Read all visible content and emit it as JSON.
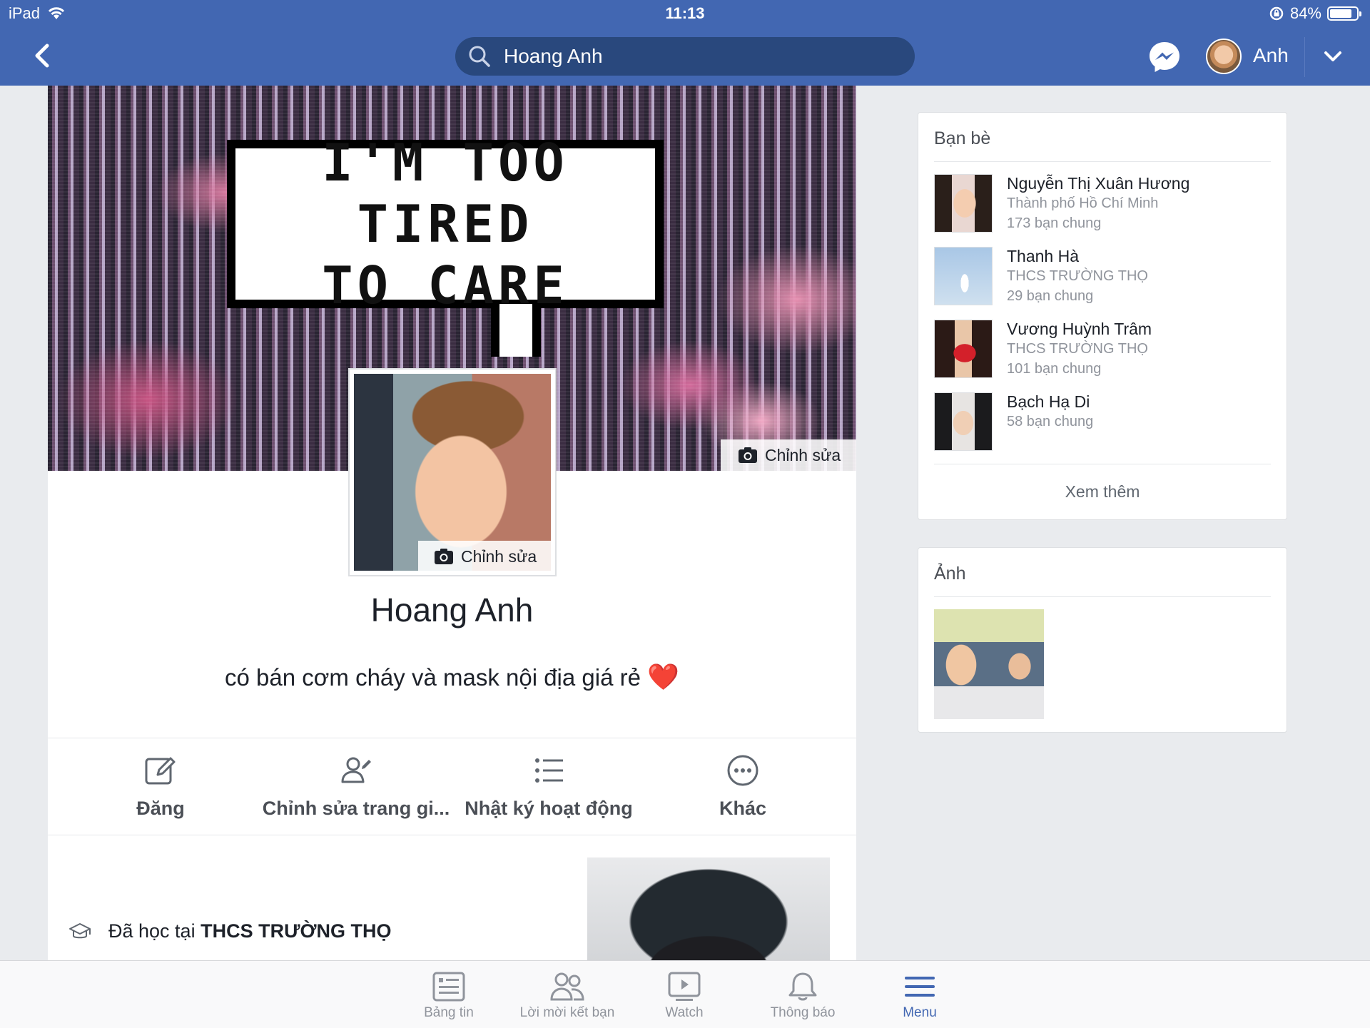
{
  "status_bar": {
    "device": "iPad",
    "time": "11:13",
    "battery": "84%",
    "battery_level": 0.84
  },
  "nav": {
    "search_value": "Hoang Anh",
    "user_name": "Anh"
  },
  "cover": {
    "text_line1": "I'M TOO TIRED",
    "text_line2": "TO CARE",
    "edit_label": "Chỉnh sửa"
  },
  "profile": {
    "avatar_edit_label": "Chỉnh sửa",
    "name": "Hoang Anh",
    "bio": "có bán cơm cháy và mask nội địa giá rẻ",
    "bio_emoji": "❤️"
  },
  "actions": [
    {
      "label": "Đăng",
      "icon": "compose-icon"
    },
    {
      "label": "Chỉnh sửa trang gi...",
      "icon": "edit-profile-icon"
    },
    {
      "label": "Nhật ký hoạt động",
      "icon": "activity-log-icon"
    },
    {
      "label": "Khác",
      "icon": "more-icon"
    }
  ],
  "intro": {
    "prefix": "Đã học tại ",
    "school": "THCS TRƯỜNG THỌ"
  },
  "friends": {
    "title": "Bạn bè",
    "items": [
      {
        "name": "Nguyễn Thị Xuân Hương",
        "line1": "Thành phố Hồ Chí Minh",
        "line2": "173 bạn chung"
      },
      {
        "name": "Thanh Hà",
        "line1": "THCS TRƯỜNG THỌ",
        "line2": "29 bạn chung"
      },
      {
        "name": "Vương Huỳnh Trâm",
        "line1": "THCS TRƯỜNG THỌ",
        "line2": "101 bạn chung"
      },
      {
        "name": "Bạch Hạ Di",
        "line1": "58 bạn chung"
      }
    ],
    "see_more": "Xem thêm"
  },
  "photos": {
    "title": "Ảnh"
  },
  "tabbar": [
    {
      "label": "Bảng tin",
      "icon": "news-feed-icon"
    },
    {
      "label": "Lời mời kết bạn",
      "icon": "friend-requests-icon"
    },
    {
      "label": "Watch",
      "icon": "watch-icon"
    },
    {
      "label": "Thông báo",
      "icon": "notifications-icon"
    },
    {
      "label": "Menu",
      "icon": "menu-icon",
      "active": true
    }
  ],
  "colors": {
    "brand": "#4267b2",
    "search_bg": "#29487d",
    "page_bg": "#e9ebee",
    "active_tab": "#4267b2"
  }
}
